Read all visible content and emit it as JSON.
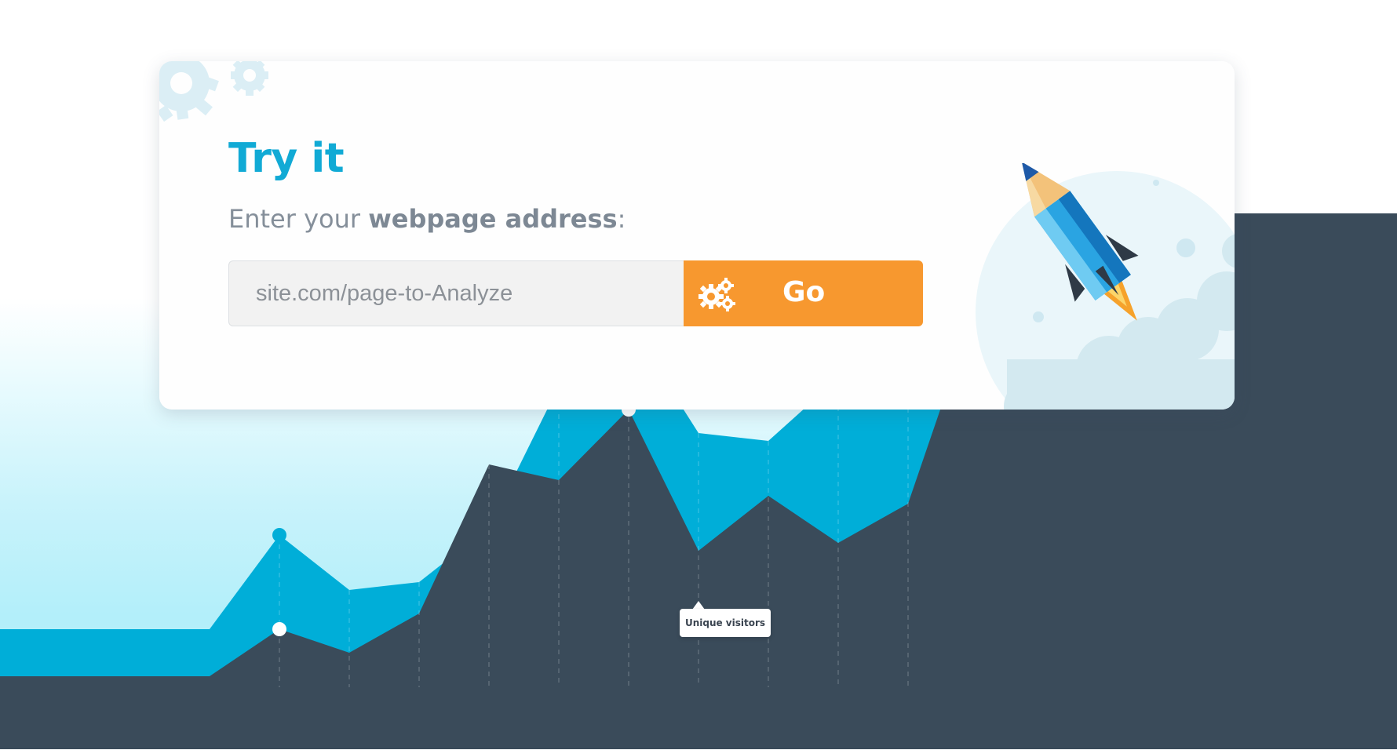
{
  "card": {
    "title": "Try it",
    "subtitle_prefix": "Enter your ",
    "subtitle_bold": "webpage address",
    "subtitle_suffix": ":",
    "url_input": {
      "placeholder": "site.com/page-to-Analyze",
      "value": ""
    },
    "go_button_label": "Go"
  },
  "icons": {
    "decor_gears": "gears-decor-icon",
    "go_gears": "gears-icon",
    "rocket": "rocket-pencil-icon"
  },
  "colors": {
    "title": "#11aad5",
    "button": "#f7982f",
    "area_dark": "#3a4b5a",
    "area_blue": "#00aed8",
    "marker_blue": "#00aed8",
    "marker_white": "#ffffff"
  },
  "chart_data": {
    "type": "area",
    "x": [
      0,
      1,
      2,
      3,
      4,
      5,
      6,
      7,
      8,
      9,
      10,
      11,
      12,
      13,
      14,
      15,
      16,
      17,
      18,
      19
    ],
    "series": [
      {
        "values": [
          6,
          6,
          6,
          6,
          18,
          11,
          12,
          19,
          37,
          45,
          31,
          30,
          38,
          57,
          66,
          56,
          56,
          56,
          56,
          56
        ]
      },
      {
        "values": [
          0,
          0,
          0,
          0,
          6,
          3,
          8,
          27,
          25,
          34,
          16,
          23,
          17,
          22,
          48,
          59,
          59,
          59,
          59,
          59
        ]
      }
    ],
    "markers": [
      4,
      9,
      15
    ],
    "tooltip_index": 9,
    "tooltip_label": "Unique visitors",
    "grid_x": true,
    "ylim": [
      0,
      75
    ]
  }
}
